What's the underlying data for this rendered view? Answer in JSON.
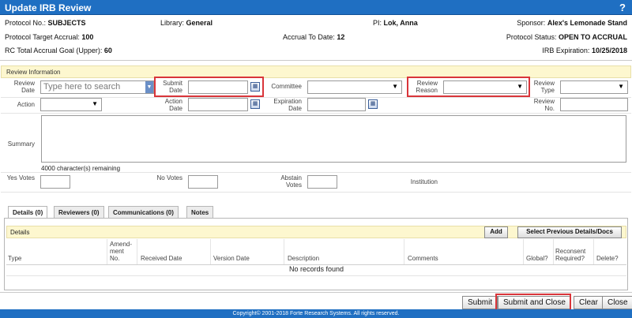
{
  "window": {
    "title": "Update IRB Review",
    "help": "?"
  },
  "header": {
    "protocol_no_label": "Protocol No.:",
    "protocol_no": "SUBJECTS",
    "library_label": "Library:",
    "library": "General",
    "pi_label": "PI:",
    "pi": "Lok, Anna",
    "sponsor_label": "Sponsor:",
    "sponsor": "Alex's Lemonade Stand",
    "target_accrual_label": "Protocol Target Accrual:",
    "target_accrual": "100",
    "accrual_to_date_label": "Accrual To Date:",
    "accrual_to_date": "12",
    "protocol_status_label": "Protocol Status:",
    "protocol_status": "OPEN TO ACCRUAL",
    "rc_goal_label": "RC Total Accrual Goal (Upper):",
    "rc_goal": "60",
    "irb_expiration_label": "IRB Expiration:",
    "irb_expiration": "10/25/2018"
  },
  "review": {
    "section_title": "Review Information",
    "review_date_label": "Review Date",
    "review_date_placeholder": "Type here to search",
    "submit_date_label": "Submit Date",
    "committee_label": "Committee",
    "review_reason_label": "Review Reason",
    "review_type_label": "Review Type",
    "action_label": "Action",
    "action_date_label": "Action Date",
    "expiration_date_label": "Expiration Date",
    "review_no_label": "Review No.",
    "summary_label": "Summary",
    "chars_remaining": "4000 character(s) remaining",
    "yes_votes_label": "Yes Votes",
    "no_votes_label": "No Votes",
    "abstain_votes_label": "Abstain Votes",
    "institution_label": "Institution"
  },
  "tabs": [
    {
      "label": "Details (0)"
    },
    {
      "label": "Reviewers (0)"
    },
    {
      "label": "Communications (0)"
    },
    {
      "label": "Notes"
    }
  ],
  "details": {
    "title": "Details",
    "add_label": "Add",
    "select_prev_label": "Select Previous Details/Docs",
    "columns": [
      "Type",
      "Amend-ment No.",
      "Received Date",
      "Version Date",
      "Description",
      "Comments",
      "Global?",
      "Reconsent Required?",
      "Delete?"
    ],
    "empty": "No records found"
  },
  "footer_buttons": {
    "submit": "Submit",
    "submit_close": "Submit and Close",
    "clear": "Clear",
    "close": "Close"
  },
  "copyright": "Copyright© 2001-2018 Forte Research Systems. All rights reserved.",
  "colors": {
    "title_bar": "#1f6fc2",
    "highlight": "#d9353a",
    "section_bg": "#fdf7cf"
  }
}
